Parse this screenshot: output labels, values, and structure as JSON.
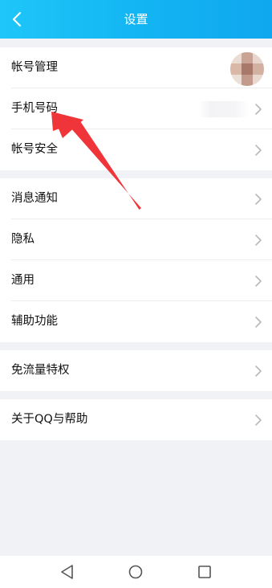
{
  "header": {
    "title": "设置"
  },
  "groups": [
    {
      "items": [
        {
          "label": "帐号管理",
          "trailing": "avatar"
        },
        {
          "label": "手机号码",
          "trailing": "blurred-value"
        },
        {
          "label": "帐号安全",
          "trailing": "chevron"
        }
      ]
    },
    {
      "items": [
        {
          "label": "消息通知"
        },
        {
          "label": "隐私"
        },
        {
          "label": "通用"
        },
        {
          "label": "辅助功能"
        }
      ]
    },
    {
      "items": [
        {
          "label": "免流量特权"
        }
      ]
    },
    {
      "items": [
        {
          "label": "关于QQ与帮助"
        }
      ]
    }
  ],
  "annotation": {
    "type": "red-arrow",
    "points_to": "手机号码",
    "color": "#f0353a"
  },
  "navbar": {
    "icons": [
      "back-triangle-icon",
      "home-circle-icon",
      "recents-square-icon"
    ]
  },
  "colors": {
    "header_gradient_start": "#1ec6f9",
    "header_gradient_end": "#0fa7ef",
    "background": "#f1f2f6",
    "chevron": "#b8b8bd"
  }
}
